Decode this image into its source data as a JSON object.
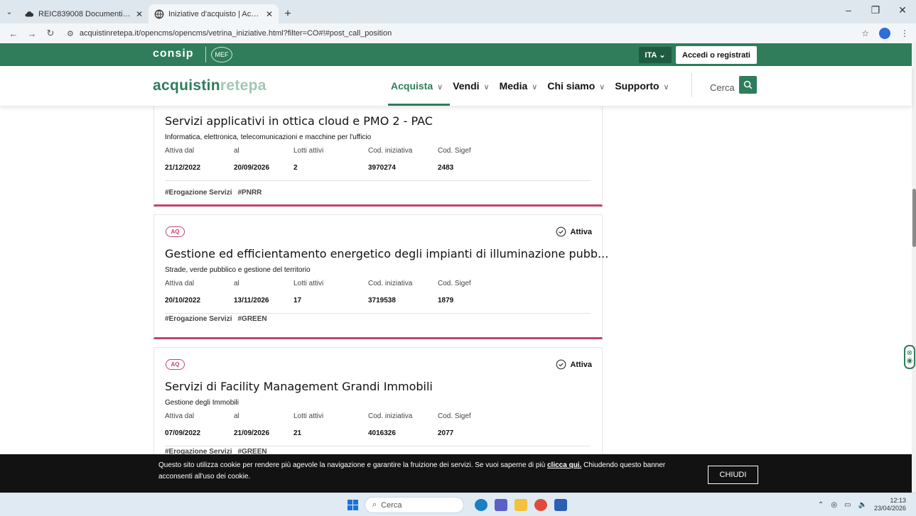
{
  "browser": {
    "tabs": [
      {
        "title": "REIC839008 Documenti per far...",
        "active": false,
        "favicon": "cloud-icon"
      },
      {
        "title": "Iniziative d'acquisto | Acquisti in...",
        "active": true,
        "favicon": "globe-icon"
      }
    ],
    "url": "acquistinretepa.it/opencms/opencms/vetrina_iniziative.html?filter=CO#!#post_call_position"
  },
  "topbar": {
    "brand": "consip",
    "mef": "MEF",
    "lang": "ITA",
    "login": "Accedi o registrati",
    "color": "#2f7d5b"
  },
  "header": {
    "logo_a": "acquistin",
    "logo_b": "rete",
    "logo_c": "pa",
    "menu": [
      "Acquista",
      "Vendi",
      "Media",
      "Chi siamo",
      "Supporto"
    ],
    "active_menu": "Acquista",
    "search_label": "Cerca"
  },
  "labels": {
    "attiva_dal": "Attiva dal",
    "al": "al",
    "lotti": "Lotti attivi",
    "cod_iniziativa": "Cod. iniziativa",
    "cod_sigef": "Cod. Sigef"
  },
  "cards": [
    {
      "badge": "",
      "status": "",
      "title": "Servizi applicativi in ottica cloud e PMO 2 - PAC",
      "category": "Informatica, elettronica, telecomunicazioni e macchine per l'ufficio",
      "attiva_dal": "21/12/2022",
      "al": "20/09/2026",
      "lotti": "2",
      "cod_iniziativa": "3970274",
      "cod_sigef": "2483",
      "tags": [
        "#Erogazione Servizi",
        "#PNRR"
      ]
    },
    {
      "badge": "AQ",
      "status": "Attiva",
      "title": "Gestione ed efficientamento energetico degli impianti di illuminazione pubb...",
      "category": "Strade, verde pubblico e gestione del territorio",
      "attiva_dal": "20/10/2022",
      "al": "13/11/2026",
      "lotti": "17",
      "cod_iniziativa": "3719538",
      "cod_sigef": "1879",
      "tags": [
        "#Erogazione Servizi",
        "#GREEN"
      ]
    },
    {
      "badge": "AQ",
      "status": "Attiva",
      "title": "Servizi di Facility Management Grandi Immobili",
      "category": "Gestione degli Immobili",
      "attiva_dal": "07/09/2022",
      "al": "21/09/2026",
      "lotti": "21",
      "cod_iniziativa": "4016326",
      "cod_sigef": "2077",
      "tags": [
        "#Erogazione Servizi",
        "#GREEN"
      ]
    }
  ],
  "cookie": {
    "text": "Questo sito utilizza cookie per rendere più agevole la navigazione e garantire la fruizione dei servizi. Se vuoi saperne di più",
    "link": "clicca qui.",
    "text2": "Chiudendo questo banner acconsenti all'uso dei cookie.",
    "button": "CHIUDI"
  },
  "taskbar": {
    "search": "Cerca",
    "time": "12:13",
    "date": "23/04/2026"
  }
}
